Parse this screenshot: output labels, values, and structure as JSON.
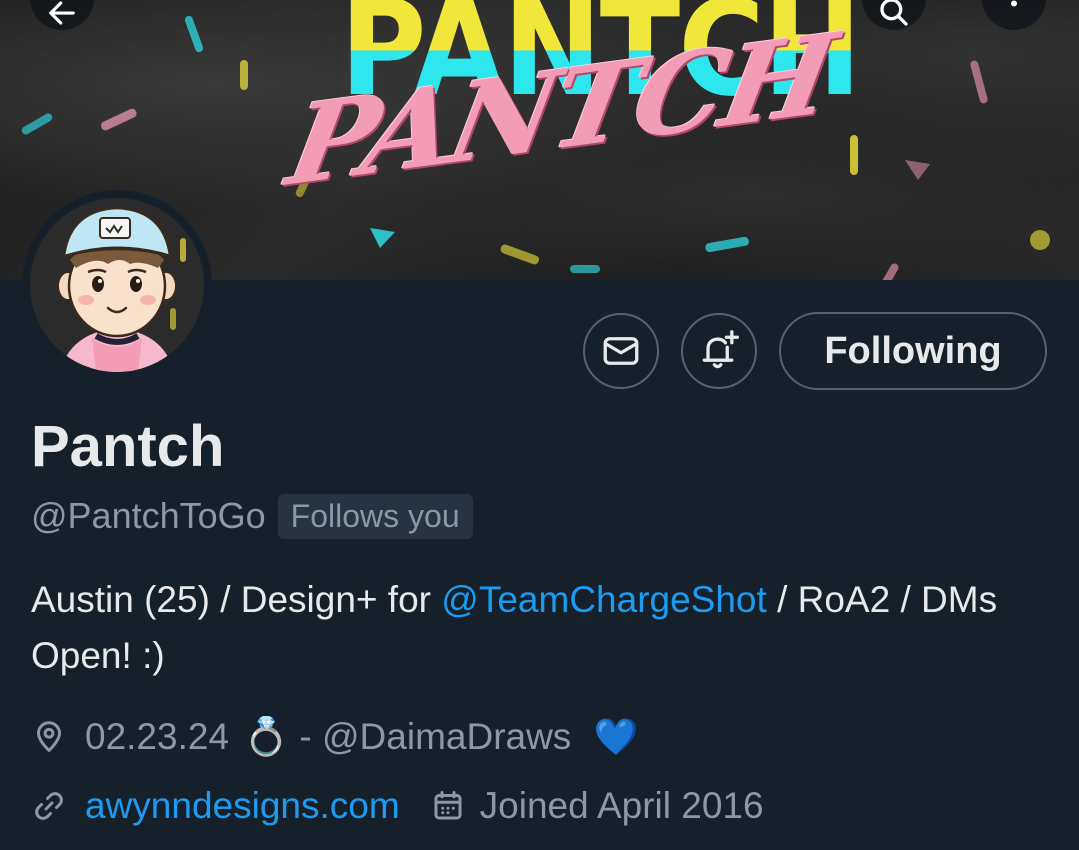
{
  "banner": {
    "title_back": "PANTCH",
    "title_front": "PANTCH"
  },
  "top_buttons": {
    "back_icon": "arrow-left-icon",
    "search_icon": "search-icon",
    "more_icon": "more-vertical-icon"
  },
  "actions": {
    "message_icon": "envelope-icon",
    "notify_icon": "bell-plus-icon",
    "following_label": "Following"
  },
  "profile": {
    "name": "Pantch",
    "handle": "@PantchToGo",
    "follows_you": "Follows you",
    "bio_part1": "Austin (25) / Design+ for ",
    "bio_mention": "@TeamChargeShot",
    "bio_part2": " / RoA2 / DMs Open! :)",
    "location_text": "02.23.24",
    "location_emoji": "💍",
    "location_suffix": " - @DaimaDraws ",
    "location_heart": "💙",
    "website": "awynndesigns.com",
    "joined": "Joined April 2016"
  },
  "colors": {
    "background": "#15202b",
    "text_primary": "#e7e9ea",
    "text_secondary": "#8b98a5",
    "link": "#1d9bf0",
    "border": "#536471"
  }
}
